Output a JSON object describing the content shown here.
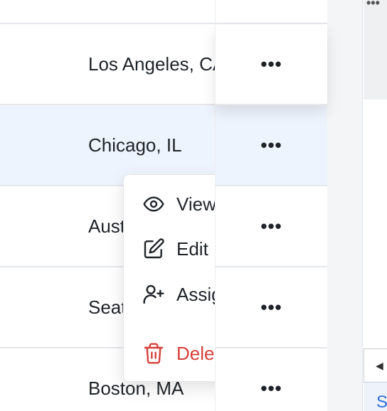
{
  "table": {
    "rows": [
      {
        "city": "",
        "actions_icon": "more-horizontal-icon",
        "selected": false
      },
      {
        "city": "Los Angeles, CA",
        "actions_icon": "more-horizontal-icon",
        "selected": false
      },
      {
        "city": "Chicago, IL",
        "actions_icon": "more-horizontal-icon",
        "selected": true
      },
      {
        "city": "Austin, TX",
        "actions_icon": "more-horizontal-icon",
        "selected": false
      },
      {
        "city": "Seattle, WA",
        "actions_icon": "more-horizontal-icon",
        "selected": false
      },
      {
        "city": "Boston, MA",
        "actions_icon": "more-horizontal-icon",
        "selected": false
      }
    ],
    "more_glyph": "•••"
  },
  "menu": {
    "items": [
      {
        "label": "View",
        "icon": "eye-icon"
      },
      {
        "label": "Edit",
        "icon": "pencil-square-icon"
      },
      {
        "label": "Assign",
        "icon": "user-plus-icon"
      },
      {
        "label": "Delete",
        "icon": "trash-icon",
        "danger": true
      }
    ]
  },
  "panel": {
    "top_glyph": "•••",
    "scroll_glyph": "◀",
    "footer_text": "S"
  },
  "colors": {
    "selected_row": "#eef4fd",
    "danger": "#d6403b",
    "link": "#2f6fdd",
    "border": "#e5e7eb"
  }
}
